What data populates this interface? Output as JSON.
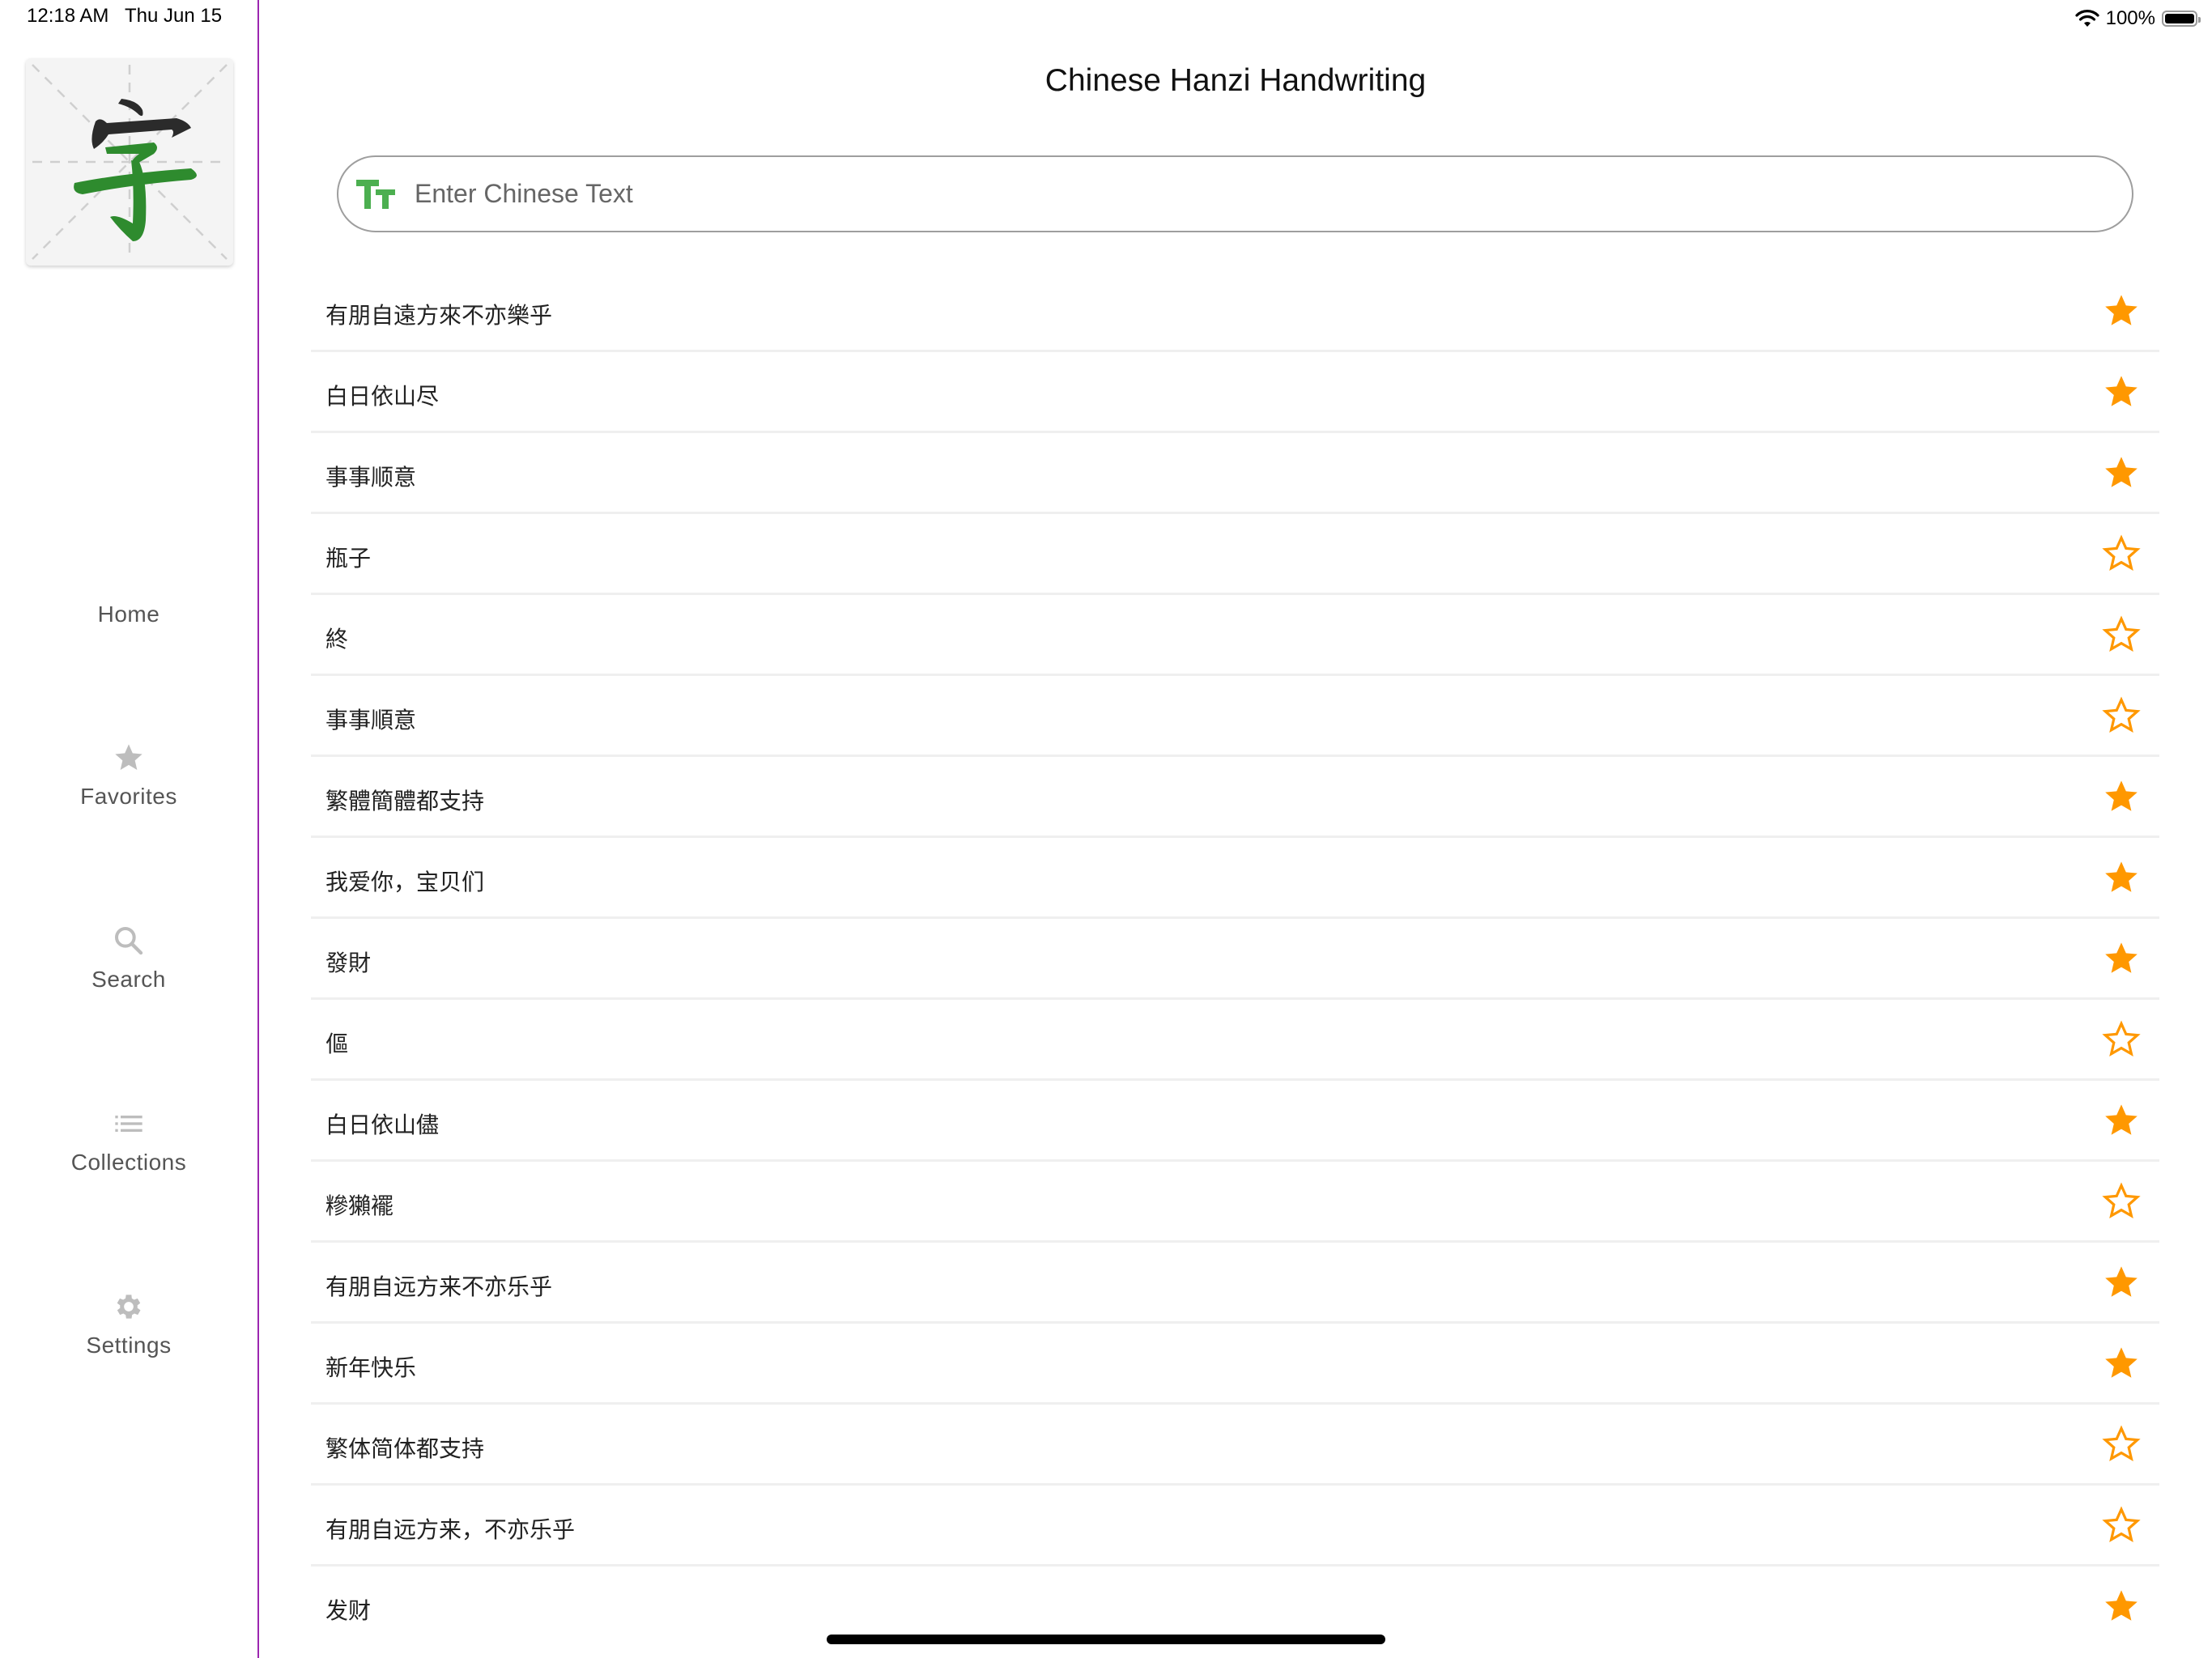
{
  "status_bar": {
    "time": "12:18 AM",
    "date": "Thu Jun 15",
    "battery": "100%",
    "battery_level": 1.0
  },
  "colors": {
    "accent": "#9C27B0",
    "star": "#FF9800",
    "logo_green": "#2E8B2E",
    "search_icon": "#4CAF50",
    "inactive_icon": "#BDBDBD",
    "inactive_label": "#555555"
  },
  "logo": {
    "character": "字",
    "icon": "hanzi-logo-icon"
  },
  "sidebar": {
    "items": [
      {
        "label": "Home",
        "icon": "home-icon",
        "active": true
      },
      {
        "label": "Favorites",
        "icon": "star-icon",
        "active": false
      },
      {
        "label": "Search",
        "icon": "search-icon",
        "active": false
      },
      {
        "label": "Collections",
        "icon": "list-icon",
        "active": false
      },
      {
        "label": "Settings",
        "icon": "gear-icon",
        "active": false
      }
    ]
  },
  "header": {
    "title": "Chinese Hanzi Handwriting"
  },
  "search": {
    "placeholder": "Enter Chinese Text",
    "value": "",
    "icon": "text-size-icon"
  },
  "list": {
    "items": [
      {
        "text": "有朋自遠方來不亦樂乎",
        "favorite": true
      },
      {
        "text": "白日依山尽",
        "favorite": true
      },
      {
        "text": "事事顺意",
        "favorite": true
      },
      {
        "text": "瓶子",
        "favorite": false
      },
      {
        "text": "終",
        "favorite": false
      },
      {
        "text": "事事順意",
        "favorite": false
      },
      {
        "text": "繁體簡體都支持",
        "favorite": true
      },
      {
        "text": "我爱你，宝贝们",
        "favorite": true
      },
      {
        "text": "發財",
        "favorite": true
      },
      {
        "text": "傴",
        "favorite": false
      },
      {
        "text": "白日依山儘",
        "favorite": true
      },
      {
        "text": "糝獺襬",
        "favorite": false
      },
      {
        "text": "有朋自远方来不亦乐乎",
        "favorite": true
      },
      {
        "text": "新年快乐",
        "favorite": true
      },
      {
        "text": "繁体简体都支持",
        "favorite": false
      },
      {
        "text": "有朋自远方来，不亦乐乎",
        "favorite": false
      },
      {
        "text": "发财",
        "favorite": true
      }
    ]
  }
}
